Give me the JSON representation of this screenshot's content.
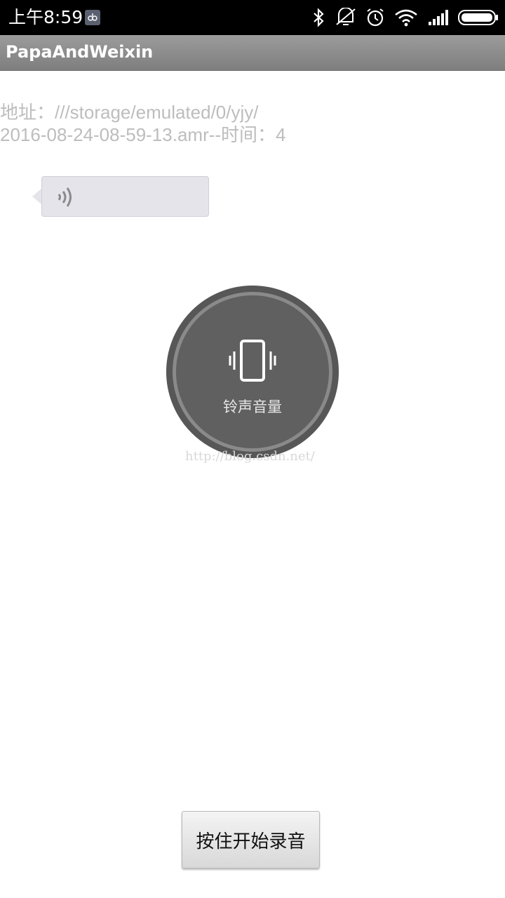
{
  "status_bar": {
    "time": "上午8:59",
    "icons": [
      "notification-icon",
      "bluetooth-icon",
      "vibrate-off-icon",
      "alarm-icon",
      "wifi-icon",
      "signal-icon",
      "battery-icon"
    ]
  },
  "app_bar": {
    "title": "PapaAndWeixin"
  },
  "record_info": {
    "line1": "地址：///storage/emulated/0/yjy/",
    "line2": "2016-08-24-08-59-13.amr--时间：4"
  },
  "voice_bubble": {
    "icon": "sound-wave-icon"
  },
  "volume_overlay": {
    "icon": "vibrate-phone-icon",
    "label": "铃声音量"
  },
  "watermark": {
    "text": "http://blog.csdn.net/"
  },
  "record_button": {
    "label": "按住开始录音"
  },
  "colors": {
    "status_bar_bg": "#000000",
    "app_bar_bg": "#8e8e8e",
    "info_text": "#bdbdbd",
    "bubble_bg": "#e4e4ea",
    "overlay_bg": "#606060"
  }
}
